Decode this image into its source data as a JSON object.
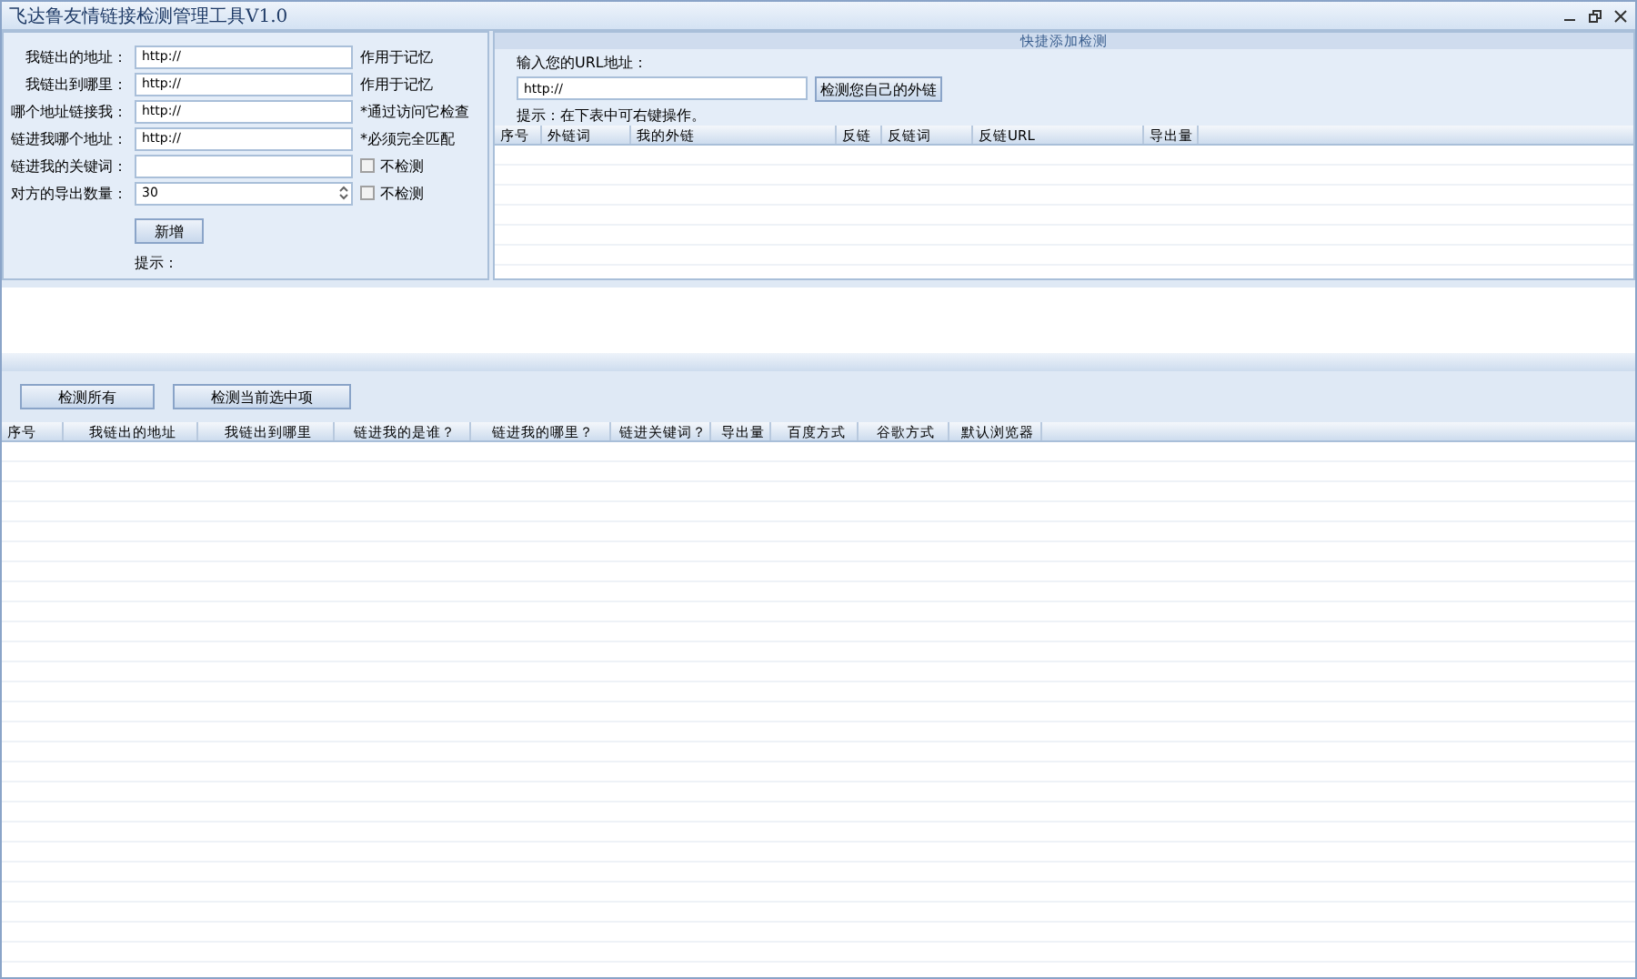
{
  "window": {
    "title": "飞达鲁友情链接检测管理工具V1.0"
  },
  "form": {
    "fields": [
      {
        "kind": "text",
        "label": "我链出的地址：",
        "value": "http://",
        "note": "作用于记忆"
      },
      {
        "kind": "text",
        "label": "我链出到哪里：",
        "value": "http://",
        "note": "作用于记忆"
      },
      {
        "kind": "text",
        "label": "哪个地址链接我：",
        "value": "http://",
        "note": "*通过访问它检查"
      },
      {
        "kind": "text",
        "label": "链进我哪个地址：",
        "value": "http://",
        "note": "*必须完全匹配"
      },
      {
        "kind": "check",
        "label": "链进我的关键词：",
        "checkbox": {
          "label": "不检测",
          "checked": false
        }
      },
      {
        "kind": "spin",
        "label": "对方的导出数量：",
        "value": "30",
        "checkbox": {
          "label": "不检测",
          "checked": false
        }
      }
    ],
    "add_button": "新增",
    "hint": "提示："
  },
  "quick": {
    "title": "快捷添加检测",
    "url_label": "输入您的URL地址：",
    "url_value": "http://",
    "check_button": "检测您自己的外链",
    "hint": "提示：在下表中可右键操作。",
    "columns": [
      "序号",
      "外链词",
      "我的外链",
      "反链",
      "反链词",
      "反链URL",
      "导出量"
    ]
  },
  "actions": [
    "检测所有",
    "检测当前选中项"
  ],
  "table": {
    "columns": [
      "序号",
      "我链出的地址",
      "我链出到哪里",
      "链进我的是谁？",
      "链进我的哪里？",
      "链进关键词？",
      "导出量",
      "百度方式",
      "谷歌方式",
      "默认浏览器"
    ]
  }
}
